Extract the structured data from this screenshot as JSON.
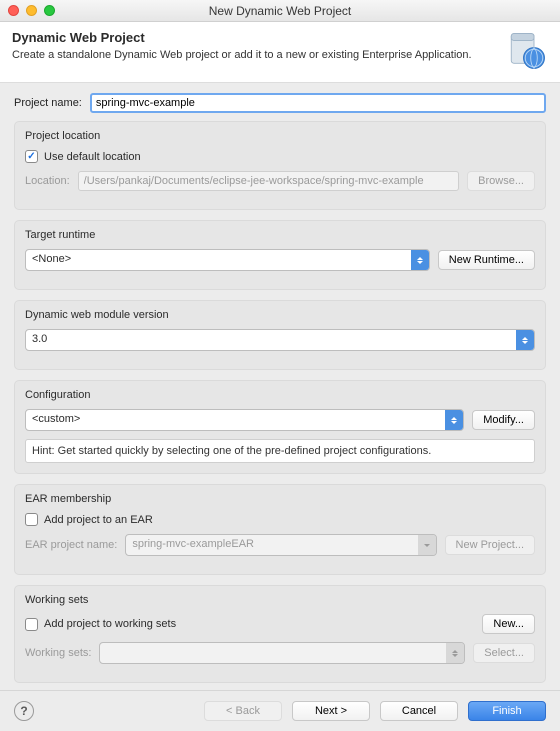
{
  "window": {
    "title": "New Dynamic Web Project"
  },
  "header": {
    "heading": "Dynamic Web Project",
    "subtext": "Create a standalone Dynamic Web project or add it to a new or existing Enterprise Application."
  },
  "project_name": {
    "label": "Project name:",
    "value": "spring-mvc-example"
  },
  "location": {
    "title": "Project location",
    "use_default_label": "Use default location",
    "use_default_checked": true,
    "location_label": "Location:",
    "location_value": "/Users/pankaj/Documents/eclipse-jee-workspace/spring-mvc-example",
    "browse_label": "Browse..."
  },
  "runtime": {
    "title": "Target runtime",
    "value": "<None>",
    "new_runtime_label": "New Runtime..."
  },
  "module_version": {
    "title": "Dynamic web module version",
    "value": "3.0"
  },
  "configuration": {
    "title": "Configuration",
    "value": "<custom>",
    "modify_label": "Modify...",
    "hint": "Hint: Get started quickly by selecting one of the pre-defined project configurations."
  },
  "ear": {
    "title": "EAR membership",
    "add_label": "Add project to an EAR",
    "add_checked": false,
    "project_name_label": "EAR project name:",
    "project_name_value": "spring-mvc-exampleEAR",
    "new_project_label": "New Project..."
  },
  "working_sets": {
    "title": "Working sets",
    "add_label": "Add project to working sets",
    "add_checked": false,
    "new_label": "New...",
    "ws_label": "Working sets:",
    "ws_value": "",
    "select_label": "Select..."
  },
  "footer": {
    "back": "< Back",
    "next": "Next >",
    "cancel": "Cancel",
    "finish": "Finish"
  }
}
